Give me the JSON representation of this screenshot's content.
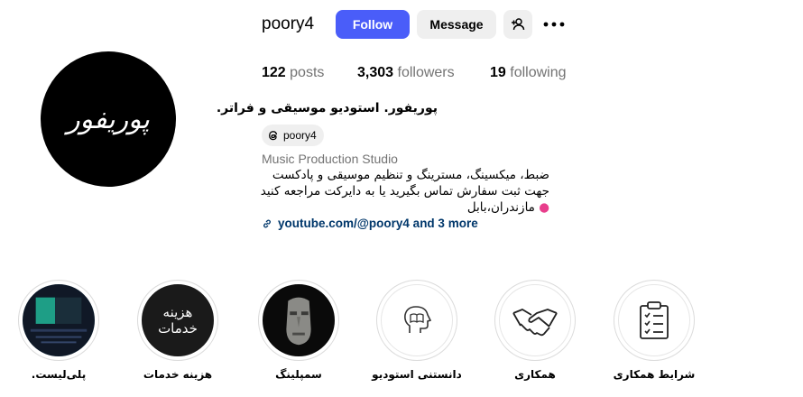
{
  "profile": {
    "avatar_text": "پوریفور",
    "username": "poory4",
    "follow_label": "Follow",
    "message_label": "Message"
  },
  "stats": {
    "posts_count": "122",
    "posts_label": "posts",
    "followers_count": "3,303",
    "followers_label": "followers",
    "following_count": "19",
    "following_label": "following"
  },
  "bio": {
    "name": "پوریفور. استودیو موسیقی و فراتر.",
    "threads_handle": "poory4",
    "category": "Music Production Studio",
    "line1": "ضبط، میکسینگ، مسترینگ و تنظیم موسیقی و پادکست",
    "line2": "جهت ثبت سفارش تماس بگیرید یا به دایرکت مراجعه کنید",
    "line3": "مازندران،بابل",
    "link": "youtube.com/@poory4 and 3 more"
  },
  "highlights": [
    {
      "label": "پلی‌لیست.",
      "icon": "playlist-thumbnail"
    },
    {
      "label": "هزینه خدمات",
      "icon": "price-thumbnail",
      "thumb_text_1": "هزینه",
      "thumb_text_2": "خدمات"
    },
    {
      "label": "سمپلینگ",
      "icon": "moai-statue-thumbnail"
    },
    {
      "label": "دانستنی استودیو",
      "icon": "head-book-icon"
    },
    {
      "label": "همکاری",
      "icon": "handshake-icon"
    },
    {
      "label": "شرایط همکاری",
      "icon": "clipboard-checklist-icon"
    }
  ],
  "colors": {
    "follow_button": "#4a5df9",
    "secondary_button": "#efefef",
    "link": "#00376b",
    "muted_text": "#737373"
  }
}
